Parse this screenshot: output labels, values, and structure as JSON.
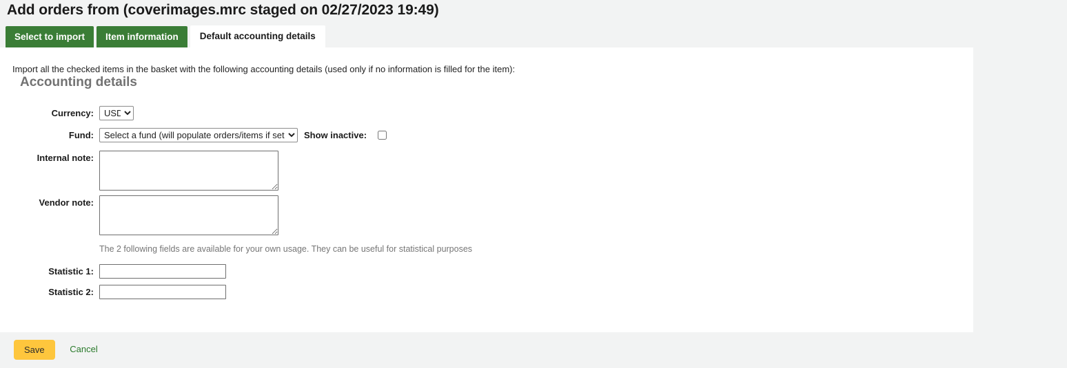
{
  "page": {
    "title": "Add orders from (coverimages.mrc staged on 02/27/2023 19:49)"
  },
  "tabs": [
    {
      "label": "Select to import",
      "active": false
    },
    {
      "label": "Item information",
      "active": false
    },
    {
      "label": "Default accounting details",
      "active": true
    }
  ],
  "main": {
    "intro": "Import all the checked items in the basket with the following accounting details (used only if no information is filled for the item):",
    "section_title": "Accounting details",
    "fields": {
      "currency": {
        "label": "Currency:",
        "value": "USD",
        "options": [
          "USD"
        ]
      },
      "fund": {
        "label": "Fund:",
        "value": "Select a fund (will populate orders/items if set)",
        "options": [
          "Select a fund (will populate orders/items if set)"
        ]
      },
      "show_inactive": {
        "label": "Show inactive:",
        "checked": false
      },
      "internal_note": {
        "label": "Internal note:",
        "value": "",
        "placeholder": ""
      },
      "vendor_note": {
        "label": "Vendor note:",
        "value": "",
        "placeholder": ""
      },
      "hint": "The 2 following fields are available for your own usage. They can be useful for statistical purposes",
      "statistic_1": {
        "label": "Statistic 1:",
        "value": "",
        "placeholder": ""
      },
      "statistic_2": {
        "label": "Statistic 2:",
        "value": "",
        "placeholder": ""
      }
    }
  },
  "actions": {
    "save_label": "Save",
    "cancel_label": "Cancel"
  },
  "colors": {
    "tab_active_bg": "#ffffff",
    "tab_bg": "#3a7d36",
    "page_bg": "#f2f3f3",
    "panel_bg": "#ffffff",
    "save_bg": "#fec63d",
    "cancel_link": "#2a7a2b",
    "section_title": "#727272",
    "hint_text": "#767676"
  }
}
